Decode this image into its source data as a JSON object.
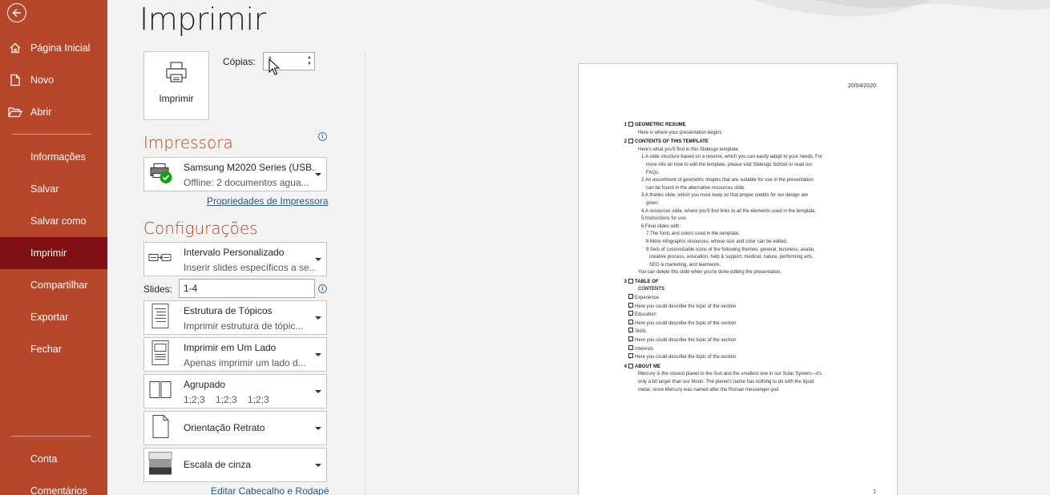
{
  "sidebar": {
    "items": [
      {
        "label": "Página Inicial",
        "icon": "home-icon"
      },
      {
        "label": "Novo",
        "icon": "new-document-icon"
      },
      {
        "label": "Abrir",
        "icon": "folder-open-icon"
      },
      {
        "label": "Informações"
      },
      {
        "label": "Salvar"
      },
      {
        "label": "Salvar como"
      },
      {
        "label": "Imprimir",
        "active": true
      },
      {
        "label": "Compartilhar"
      },
      {
        "label": "Exportar"
      },
      {
        "label": "Fechar"
      },
      {
        "label": "Conta"
      },
      {
        "label": "Comentários"
      }
    ]
  },
  "main": {
    "title": "Imprimir",
    "print_button": "Imprimir",
    "copies_label": "Cópias:",
    "copies_value": "1"
  },
  "printer": {
    "heading": "Impressora",
    "name": "Samsung M2020 Series (USB...",
    "status": "Offline: 2 documentos agua...",
    "properties_link": "Propriedades de Impressora"
  },
  "settings": {
    "heading": "Configurações",
    "range": {
      "title": "Intervalo Personalizado",
      "sub": "Inserir slides específicos a se..."
    },
    "slides_label": "Slides:",
    "slides_value": "1-4",
    "layout": {
      "title": "Estrutura de Tópicos",
      "sub": "Imprimir estrutura de tópic..."
    },
    "sides": {
      "title": "Imprimir em Um Lado",
      "sub": "Apenas imprimir um lado d..."
    },
    "collate": {
      "title": "Agrupado",
      "sub": "1;2;3    1;2;3    1;2;3"
    },
    "orientation": {
      "title": "Orientação Retrato"
    },
    "color": {
      "title": "Escala de cinza"
    },
    "header_footer_link": "Editar Cabeçalho e Rodapé"
  },
  "preview": {
    "date": "20/04/2020",
    "page_number": "1",
    "lines": [
      {
        "n": "1",
        "text": "GEOMETRIC RESUME",
        "heading": true
      },
      {
        "text": "Here is where your presentation begins",
        "indent": 1
      },
      {
        "n": "2",
        "text": "CONTENTS OF THIS TEMPLATE",
        "heading": true
      },
      {
        "text": "Here's what you'll find in this Slidesgo template:",
        "indent": 1
      },
      {
        "text": "1.A slide structure based on a resume, which you can easily adapt to your needs. For",
        "indent": 2
      },
      {
        "text": "more info on how to edit the template, please visit Slidesgo School or read our",
        "indent": 3
      },
      {
        "text": "FAQs.",
        "indent": 3
      },
      {
        "text": "2.An assortment of geometric shapes that are suitable for use in the presentation",
        "indent": 2
      },
      {
        "text": "can be found in the alternative resources slide.",
        "indent": 3
      },
      {
        "text": "3.A thanks slide, which you must keep so that proper credits for our design are",
        "indent": 2
      },
      {
        "text": "given.",
        "indent": 3
      },
      {
        "text": "4.A resources slide, where you'll find links to all the elements used in the template.",
        "indent": 2
      },
      {
        "text": "5.Instructions for use.",
        "indent": 2
      },
      {
        "text": "6.Final slides with:",
        "indent": 2
      },
      {
        "text": "7.The fonts and colors used in the template.",
        "indent": 3
      },
      {
        "text": "8.More infographic resources, whose size and color can be edited.",
        "indent": 3
      },
      {
        "text": "9.Sets of customizable icons of the following themes: general, business, avatar,",
        "indent": 3
      },
      {
        "text": "creative process, education, help & support, medical, nature, performing arts,",
        "indent": 4
      },
      {
        "text": "SEO & marketing, and teamwork.",
        "indent": 4
      },
      {
        "text": "You can delete this slide when you're done editing the presentation.",
        "indent": 1
      },
      {
        "n": "3",
        "text": "TABLE OF",
        "heading": true
      },
      {
        "text": "CONTENTS",
        "indent": 1,
        "bold": true
      },
      {
        "text": "Experience",
        "box": "1"
      },
      {
        "text": "Here you could describe the topic of the section",
        "box": "2"
      },
      {
        "text": "Education",
        "box": "3"
      },
      {
        "text": "Here you could describe the topic of the section",
        "box": "4"
      },
      {
        "text": "Skills",
        "box": "5"
      },
      {
        "text": "Here you could describe the topic of the section",
        "box": "6"
      },
      {
        "text": "Interests",
        "box": "7"
      },
      {
        "text": "Here you could describe the topic of the section",
        "box": "8"
      },
      {
        "n": "4",
        "text": "ABOUT ME",
        "heading": true
      },
      {
        "text": "Mercury is the closest planet to the Sun and the smallest one in our Solar System—it's",
        "indent": 1
      },
      {
        "text": "only a bit larger than our Moon. The planet's name has nothing to do with the liquid",
        "indent": 1
      },
      {
        "text": "metal, since Mercury was named after the Roman messenger god",
        "indent": 1
      }
    ]
  }
}
